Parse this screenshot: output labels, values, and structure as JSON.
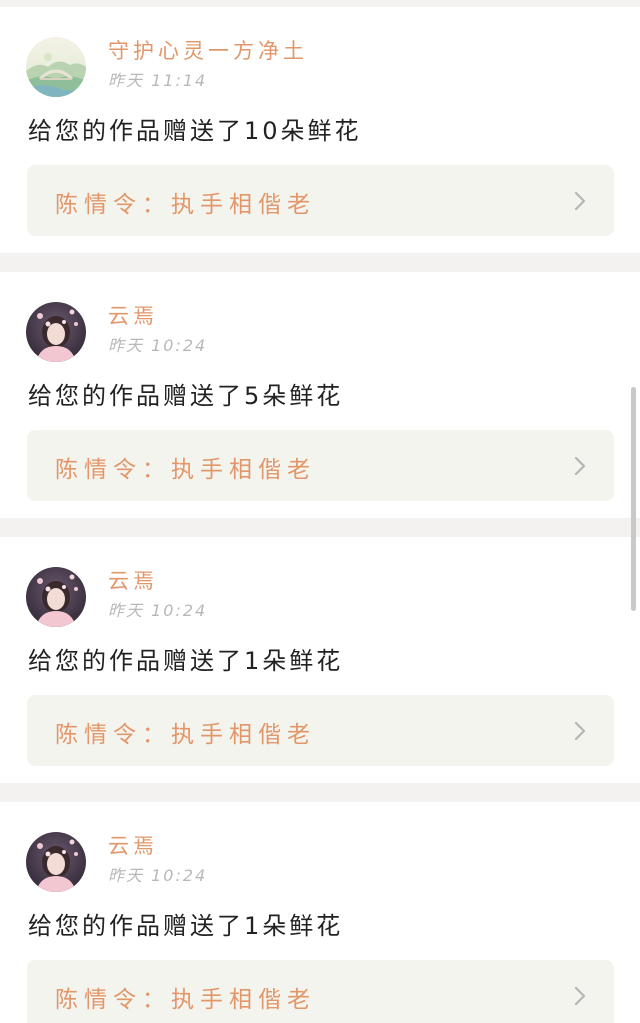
{
  "colors": {
    "accent": "#e2976a",
    "card_bg": "#ffffff",
    "page_bg": "#f3f2f0",
    "link_bg": "#f4f4ee",
    "muted": "#b8b8b8",
    "chevron": "#b5b5b5"
  },
  "notifications": [
    {
      "user_name": "守护心灵一方净土",
      "time": "昨天 11:14",
      "message": "给您的作品赠送了10朵鲜花",
      "work_title": "陈情令：执手相偕老",
      "avatar": "landscape-avatar",
      "chevron": "chevron-right-icon"
    },
    {
      "user_name": "云焉",
      "time": "昨天 10:24",
      "message": "给您的作品赠送了5朵鲜花",
      "work_title": "陈情令：执手相偕老",
      "avatar": "girl-avatar",
      "chevron": "chevron-right-icon"
    },
    {
      "user_name": "云焉",
      "time": "昨天 10:24",
      "message": "给您的作品赠送了1朵鲜花",
      "work_title": "陈情令：执手相偕老",
      "avatar": "girl-avatar",
      "chevron": "chevron-right-icon"
    },
    {
      "user_name": "云焉",
      "time": "昨天 10:24",
      "message": "给您的作品赠送了1朵鲜花",
      "work_title": "陈情令：执手相偕老",
      "avatar": "girl-avatar",
      "chevron": "chevron-right-icon"
    }
  ]
}
